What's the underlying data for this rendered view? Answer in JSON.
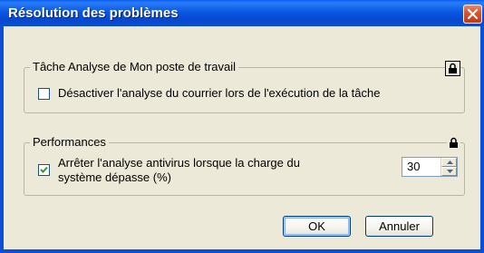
{
  "window": {
    "title": "Résolution des problèmes",
    "close_icon": "close-icon"
  },
  "group_scan": {
    "legend": "Tâche Analyse de Mon poste de travail",
    "lock_icon": "lock-icon",
    "checkbox": {
      "label": "Désactiver l'analyse du courrier lors de l'exécution de la tâche",
      "checked": false
    }
  },
  "group_perf": {
    "legend": "Performances",
    "lock_icon": "lock-icon",
    "checkbox": {
      "label_line1": "Arrêter l'analyse antivirus lorsque la charge du",
      "label_line2": "système dépasse (%)",
      "checked": true
    },
    "spinner": {
      "value": "30"
    }
  },
  "buttons": {
    "ok": "OK",
    "cancel": "Annuler"
  },
  "colors": {
    "titlebar": "#0747d1",
    "dialog_bg": "#ece9d8",
    "close_button": "#c23a14"
  }
}
